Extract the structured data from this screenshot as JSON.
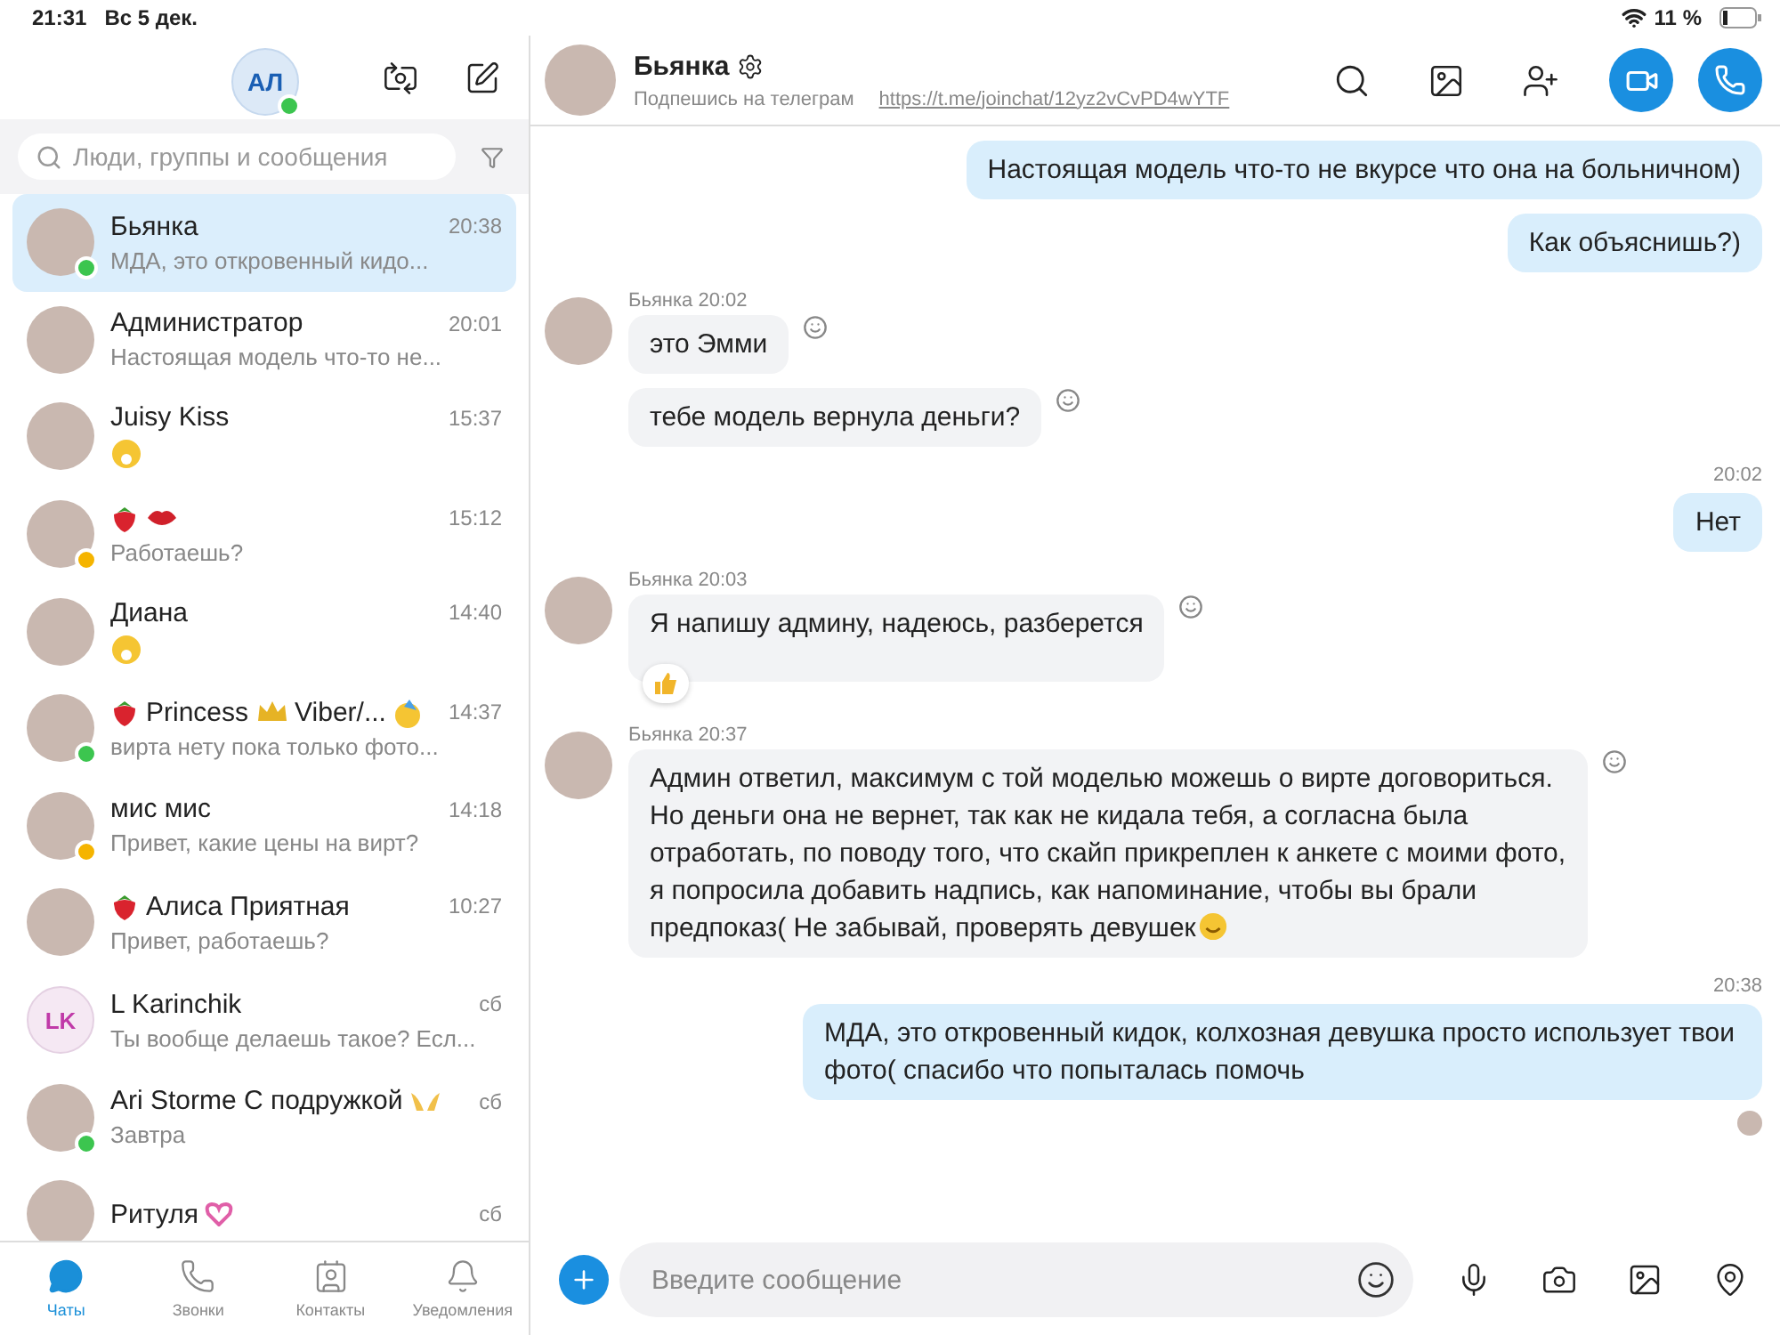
{
  "status_bar": {
    "time": "21:31",
    "date": "Вс 5 дек.",
    "battery": "11 %"
  },
  "profile": {
    "initials": "АЛ",
    "online": true
  },
  "search": {
    "placeholder": "Люди, группы и сообщения"
  },
  "chats": [
    {
      "name_parts": [
        {
          "kind": "text",
          "text": "Бьянка"
        }
      ],
      "time": "20:38",
      "preview": "МДА, это откровенный кидо...",
      "avatar": {
        "kind": "photo"
      },
      "online": true,
      "away": false,
      "selected": true
    },
    {
      "name_parts": [
        {
          "kind": "text",
          "text": "Администратор"
        }
      ],
      "time": "20:01",
      "preview": "Настоящая модель что-то не...",
      "avatar": {
        "kind": "photo"
      },
      "online": false,
      "away": false,
      "selected": false
    },
    {
      "name_parts": [
        {
          "kind": "text",
          "text": "Juisy Kiss"
        }
      ],
      "time": "15:37",
      "preview_emoji": true,
      "avatar": {
        "kind": "photo"
      },
      "online": false,
      "away": false,
      "selected": false
    },
    {
      "name_parts": [
        {
          "kind": "strawberry"
        },
        {
          "kind": "lips"
        }
      ],
      "time": "15:12",
      "preview": "Работаешь?",
      "avatar": {
        "kind": "photo"
      },
      "away": true,
      "selected": false
    },
    {
      "name_parts": [
        {
          "kind": "text",
          "text": "Диана"
        }
      ],
      "time": "14:40",
      "preview_emoji": true,
      "avatar": {
        "kind": "photo"
      },
      "online": false,
      "away": false,
      "selected": false
    },
    {
      "name_parts": [
        {
          "kind": "strawberry"
        },
        {
          "kind": "text",
          "text": "Princess"
        },
        {
          "kind": "crown"
        },
        {
          "kind": "text",
          "text": "Viber/..."
        },
        {
          "kind": "party"
        }
      ],
      "time": "14:37",
      "preview": "вирта нету пока только фото...",
      "avatar": {
        "kind": "photo"
      },
      "online": true,
      "away": false,
      "selected": false
    },
    {
      "name_parts": [
        {
          "kind": "text",
          "text": "мис мис"
        }
      ],
      "time": "14:18",
      "preview": "Привет, какие цены на вирт?",
      "avatar": {
        "kind": "photo"
      },
      "away": true,
      "selected": false
    },
    {
      "name_parts": [
        {
          "kind": "strawberry"
        },
        {
          "kind": "text",
          "text": "Алиса Приятная"
        }
      ],
      "time": "10:27",
      "preview": "Привет, работаешь?",
      "avatar": {
        "kind": "photo"
      },
      "online": false,
      "away": false,
      "selected": false
    },
    {
      "name_parts": [
        {
          "kind": "text",
          "text": "L Karinchik"
        }
      ],
      "time": "сб",
      "preview": "Ты вообще делаешь такое? Есл...",
      "avatar": {
        "kind": "initials",
        "text": "LK"
      },
      "online": false,
      "away": false,
      "selected": false
    },
    {
      "name_parts": [
        {
          "kind": "text",
          "text": "Ari Storme С подружкой"
        },
        {
          "kind": "hands"
        }
      ],
      "time": "сб",
      "preview": "Завтра",
      "avatar": {
        "kind": "photo"
      },
      "online": true,
      "away": false,
      "selected": false
    },
    {
      "name_parts": [
        {
          "kind": "text",
          "text": "Ритуля"
        },
        {
          "kind": "heart"
        }
      ],
      "time": "сб",
      "avatar": {
        "kind": "photo"
      },
      "online": false,
      "away": false,
      "selected": false
    }
  ],
  "tabs": [
    {
      "label": "Чаты",
      "selected": true
    },
    {
      "label": "Звонки",
      "selected": false
    },
    {
      "label": "Контакты",
      "selected": false
    },
    {
      "label": "Уведомления",
      "selected": false
    }
  ],
  "conversation": {
    "name": "Бьянка",
    "subtitle": "Подпешись на телеграм",
    "link": "https://t.me/joinchat/12yz2vCvPD4wYTF",
    "placeholder": "Введите сообщение"
  },
  "messages": [
    {
      "kind": "outgoing",
      "bubbles": [
        {
          "text": "Настоящая модель что-то не вкурсе что она на больничном)"
        },
        {
          "text": "Как объяснишь?)"
        }
      ]
    },
    {
      "kind": "incoming",
      "sender": "Бьянка 20:02",
      "bubbles": [
        {
          "text": "это Эмми"
        },
        {
          "text": "тебе модель вернула деньги?"
        }
      ]
    },
    {
      "kind": "outgoing",
      "time": "20:02",
      "bubbles": [
        {
          "text": "Нет"
        }
      ]
    },
    {
      "kind": "incoming",
      "sender": "Бьянка 20:03",
      "bubbles": [
        {
          "text": "Я напишу админу, надеюсь, разберется",
          "reaction": true
        }
      ]
    },
    {
      "kind": "incoming",
      "sender": "Бьянка 20:37",
      "bubbles": [
        {
          "text": "Админ ответил, максимум с той моделью можешь о вирте договориться. Но деньги она не вернет, так как не кидала тебя, а согласна была отработать, по поводу того, что скайп прикреплен к анкете с моими фото, я попросила добавить надпись, как напоминание, чтобы вы брали предпоказ( Не забывай, проверять девушек",
          "trailing_emoji": true
        }
      ]
    },
    {
      "kind": "outgoing",
      "time": "20:38",
      "read": true,
      "bubbles": [
        {
          "text": "МДА, это откровенный кидок, колхозная девушка просто использует твои фото( спасибо что попыталась помочь"
        }
      ]
    }
  ]
}
